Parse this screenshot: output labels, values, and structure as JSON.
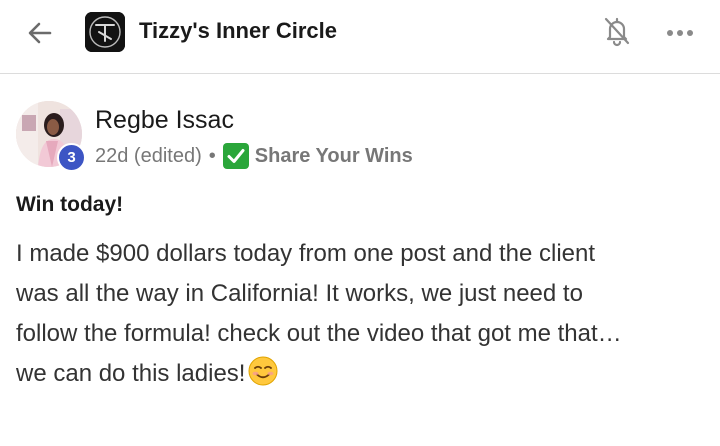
{
  "header": {
    "title": "Tizzy's Inner Circle",
    "logo_text": "TIC"
  },
  "post": {
    "author": "Regbe Issac",
    "level": "3",
    "time": "22d (edited)",
    "separator": "•",
    "category": "Share Your Wins",
    "title": "Win today!",
    "body_lines": [
      "I made $900 dollars today from one post and the client",
      "was all the way in California! It works, we just need to",
      "follow the formula! check out the video that got me that…",
      "we can do this ladies!"
    ]
  },
  "colors": {
    "badge": "#3d55c4",
    "category_check": "#2aa63a",
    "meta_text": "#777777"
  },
  "icons": {
    "back": "arrow-left",
    "bell": "bell-off",
    "more": "ellipsis-horizontal",
    "category": "check-mark-button",
    "emoji": "smiling-face"
  }
}
